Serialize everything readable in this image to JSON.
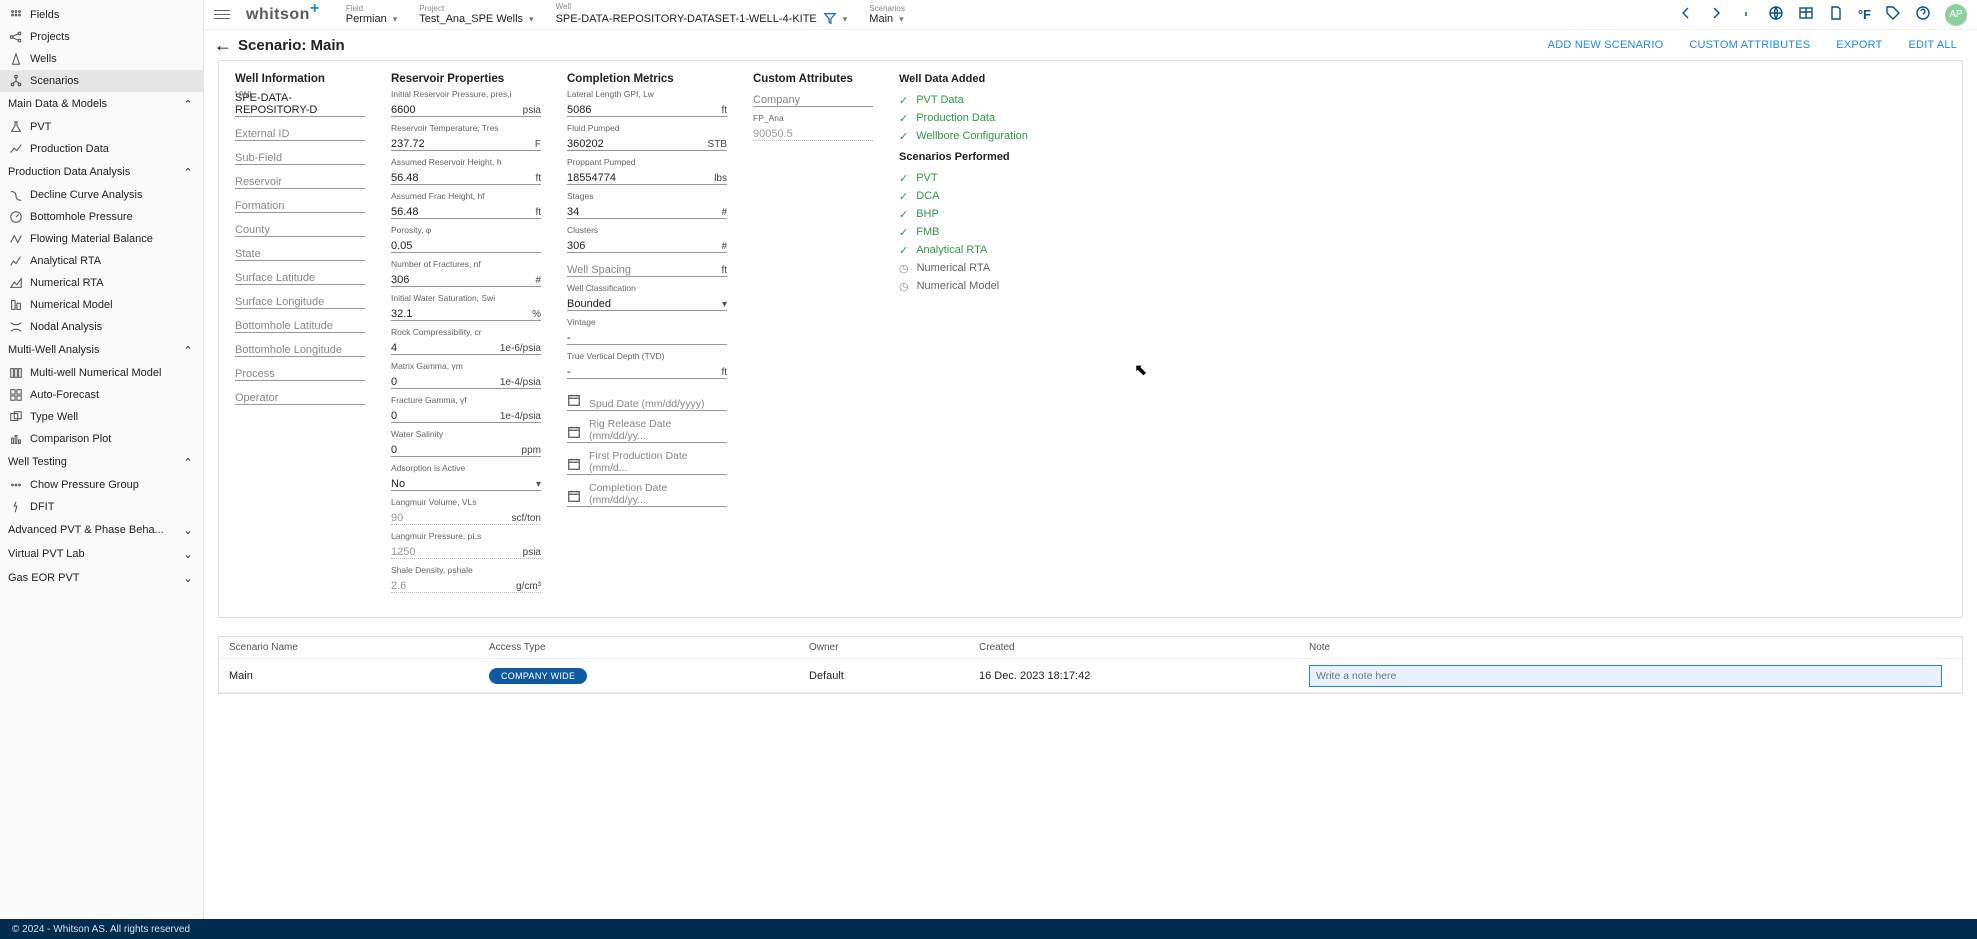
{
  "sidebar": {
    "top": [
      {
        "label": "Fields"
      },
      {
        "label": "Projects"
      },
      {
        "label": "Wells"
      },
      {
        "label": "Scenarios"
      }
    ],
    "sections": {
      "main_data": {
        "label": "Main Data & Models",
        "items": [
          {
            "label": "PVT"
          },
          {
            "label": "Production Data"
          }
        ]
      },
      "pda": {
        "label": "Production Data Analysis",
        "items": [
          {
            "label": "Decline Curve Analysis"
          },
          {
            "label": "Bottomhole Pressure"
          },
          {
            "label": "Flowing Material Balance"
          },
          {
            "label": "Analytical RTA"
          },
          {
            "label": "Numerical RTA"
          },
          {
            "label": "Numerical Model"
          },
          {
            "label": "Nodal Analysis"
          }
        ]
      },
      "mwa": {
        "label": "Multi-Well Analysis",
        "items": [
          {
            "label": "Multi-well Numerical Model"
          },
          {
            "label": "Auto-Forecast"
          },
          {
            "label": "Type Well"
          },
          {
            "label": "Comparison Plot"
          }
        ]
      },
      "wt": {
        "label": "Well Testing",
        "items": [
          {
            "label": "Chow Pressure Group"
          },
          {
            "label": "DFIT"
          }
        ]
      },
      "apvt": {
        "label": "Advanced PVT & Phase Beha...",
        "items": []
      },
      "vpl": {
        "label": "Virtual PVT Lab",
        "items": []
      },
      "eor": {
        "label": "Gas EOR PVT",
        "items": []
      }
    }
  },
  "topbar": {
    "logo": "whitson",
    "crumbs": {
      "field": {
        "k": "Field",
        "v": "Permian"
      },
      "project": {
        "k": "Project",
        "v": "Test_Ana_SPE Wells"
      },
      "well": {
        "k": "Well",
        "v": "SPE-DATA-REPOSITORY-DATASET-1-WELL-4-KITE"
      },
      "scenario": {
        "k": "Scenarios",
        "v": "Main"
      }
    },
    "avatar": "AP"
  },
  "title": {
    "text": "Scenario: Main"
  },
  "actions": {
    "add": "ADD NEW SCENARIO",
    "attr": "CUSTOM ATTRIBUTES",
    "export": "EXPORT",
    "edit": "EDIT ALL"
  },
  "well_info": {
    "heading": "Well Information",
    "uwi_l": "UWI",
    "uwi": "SPE-DATA-REPOSITORY-D",
    "ext_l": "External ID",
    "sub_l": "Sub-Field",
    "res_l": "Reservoir",
    "for_l": "Formation",
    "cty_l": "County",
    "sta_l": "State",
    "slat_l": "Surface Latitude",
    "slon_l": "Surface Longitude",
    "blat_l": "Bottomhole Latitude",
    "blon_l": "Bottomhole Longitude",
    "proc_l": "Process",
    "oper_l": "Operator"
  },
  "res_props": {
    "heading": "Reservoir Properties",
    "f": [
      {
        "l": "Initial Reservoir Pressure, pres,i",
        "v": "6600",
        "u": "psia"
      },
      {
        "l": "Reservoir Temperature, Tres",
        "v": "237.72",
        "u": "F"
      },
      {
        "l": "Assumed Reservoir Height, h",
        "v": "56.48",
        "u": "ft"
      },
      {
        "l": "Assumed Frac Height, hf",
        "v": "56.48",
        "u": "ft"
      },
      {
        "l": "Porosity, φ",
        "v": "0.05",
        "u": ""
      },
      {
        "l": "Number of Fractures, nf",
        "v": "306",
        "u": "#"
      },
      {
        "l": "Initial Water Saturation, Swi",
        "v": "32.1",
        "u": "%"
      },
      {
        "l": "Rock Compressibility, cr",
        "v": "4",
        "u": "1e-6/psia"
      },
      {
        "l": "Matrix Gamma, γm",
        "v": "0",
        "u": "1e-4/psia"
      },
      {
        "l": "Fracture Gamma, γf",
        "v": "0",
        "u": "1e-4/psia"
      },
      {
        "l": "Water Salinity",
        "v": "0",
        "u": "ppm"
      },
      {
        "l": "Adsorption is Active",
        "v": "No",
        "u": "",
        "select": true
      },
      {
        "l": "Langmuir Volume, VLs",
        "v": "90",
        "u": "scf/ton",
        "dotted": true
      },
      {
        "l": "Langmuir Pressure, pLs",
        "v": "1250",
        "u": "psia",
        "dotted": true
      },
      {
        "l": "Shale Density, ρshale",
        "v": "2.6",
        "u": "g/cm³",
        "dotted": true
      }
    ]
  },
  "completion": {
    "heading": "Completion Metrics",
    "f": [
      {
        "l": "Lateral Length GPI, Lw",
        "v": "5086",
        "u": "ft"
      },
      {
        "l": "Fluid Pumped",
        "v": "360202",
        "u": "STB"
      },
      {
        "l": "Proppant Pumped",
        "v": "18554774",
        "u": "lbs"
      },
      {
        "l": "Stages",
        "v": "34",
        "u": "#"
      },
      {
        "l": "Clusters",
        "v": "306",
        "u": "#"
      },
      {
        "l": "Well Spacing",
        "v": "",
        "u": "ft",
        "ph": true
      },
      {
        "l": "Well Classification",
        "v": "Bounded",
        "u": "",
        "select": true
      },
      {
        "l": "Vintage",
        "v": "-",
        "u": ""
      },
      {
        "l": "True Vertical Depth (TVD)",
        "v": "-",
        "u": "ft"
      }
    ],
    "dates": [
      "Spud Date (mm/dd/yyyy)",
      "Rig Release Date (mm/dd/yy...",
      "First Production Date (mm/d...",
      "Completion Date (mm/dd/yy..."
    ]
  },
  "custom": {
    "heading": "Custom Attributes",
    "f": [
      {
        "l": "Company",
        "v": "",
        "ph": true
      },
      {
        "l": "FP_Ana",
        "v": "90050.5",
        "dotted": true
      }
    ]
  },
  "wda": {
    "heading1": "Well Data Added",
    "added": [
      "PVT Data",
      "Production Data",
      "Wellbore Configuration"
    ],
    "heading2": "Scenarios Performed",
    "done": [
      "PVT",
      "DCA",
      "BHP",
      "FMB",
      "Analytical RTA"
    ],
    "pending": [
      "Numerical RTA",
      "Numerical Model"
    ]
  },
  "scenario_table": {
    "headers": {
      "name": "Scenario Name",
      "access": "Access Type",
      "owner": "Owner",
      "created": "Created",
      "note": "Note"
    },
    "row": {
      "name": "Main",
      "access": "COMPANY WIDE",
      "owner": "Default",
      "created": "16 Dec. 2023 18:17:42",
      "note_ph": "Write a note here"
    }
  },
  "footer": "© 2024 - Whitson AS. All rights reserved"
}
